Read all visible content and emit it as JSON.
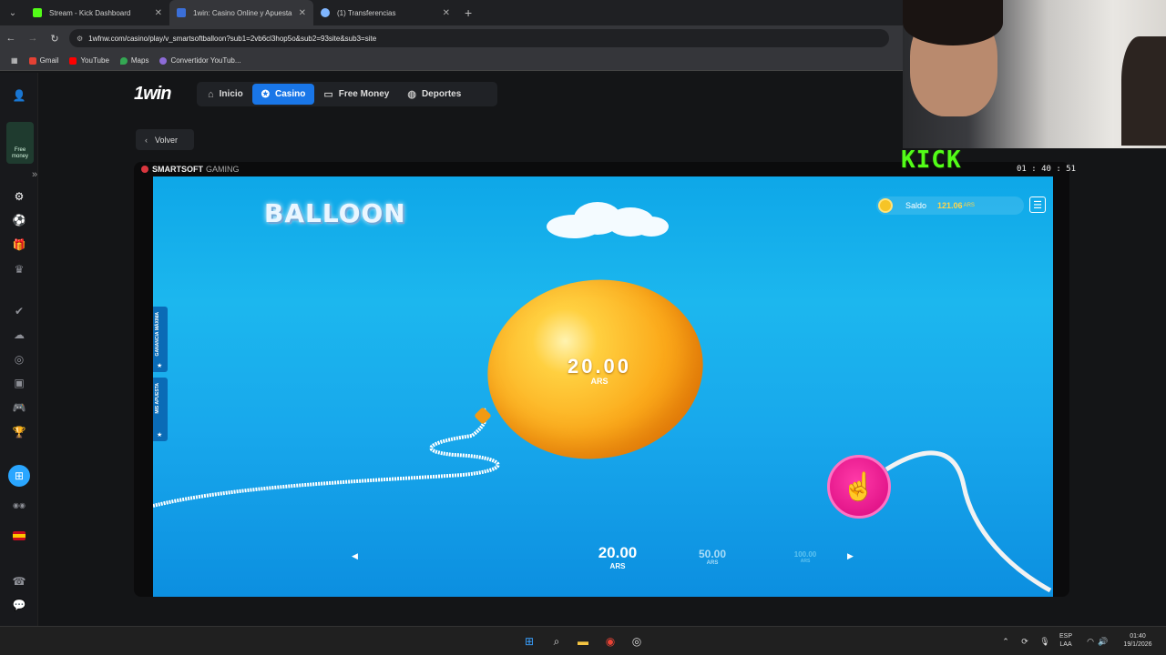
{
  "browser": {
    "tabs": [
      {
        "title": "Stream - Kick Dashboard",
        "color": "#53fc18"
      },
      {
        "title": "1win: Casino Online y Apuesta",
        "color": "#3b6fd8"
      },
      {
        "title": "(1) Transferencias",
        "color": "#7fb6ff"
      }
    ],
    "url": "1wfnw.com/casino/play/v_smartsoftballoon?sub1=2vb6cl3hop5o&sub2=93site&sub3=site",
    "bookmarks": [
      "Gmail",
      "YouTube",
      "Maps",
      "Convertidor YouTub..."
    ]
  },
  "site": {
    "brand": "1win",
    "nav": [
      {
        "label": "Inicio",
        "icon": "home-icon"
      },
      {
        "label": "Casino",
        "icon": "casino-chip-icon"
      },
      {
        "label": "Free Money",
        "icon": "money-icon"
      },
      {
        "label": "Deportes",
        "icon": "sports-ball-icon"
      }
    ],
    "back_label": "Volver",
    "free_money_label": "Free money"
  },
  "game": {
    "provider": "SMARTSOFT",
    "provider_suffix": "GAMING",
    "logo": "BALLOON",
    "balance_label": "Saldo",
    "balance_value": "121.06",
    "balance_currency": "ARS",
    "side_tabs": [
      "GANANCIA MÁXIMA",
      "MIS APUESTA"
    ],
    "balloon_value": "20.00",
    "balloon_currency": "ARS",
    "bets": [
      {
        "value": "20.00",
        "currency": "ARS"
      },
      {
        "value": "50.00",
        "currency": "ARS"
      },
      {
        "value": "100.00",
        "currency": "ARS"
      }
    ],
    "sky_color": "#14aeee",
    "balloon_color": "#fba91a",
    "pump_color": "#e0128c"
  },
  "stream": {
    "kick_label": "KICK",
    "clock": "01 : 40 : 51"
  },
  "taskbar": {
    "lang_1": "ESP",
    "lang_2": "LAA",
    "time": "01:40",
    "date": "19/1/2026"
  }
}
